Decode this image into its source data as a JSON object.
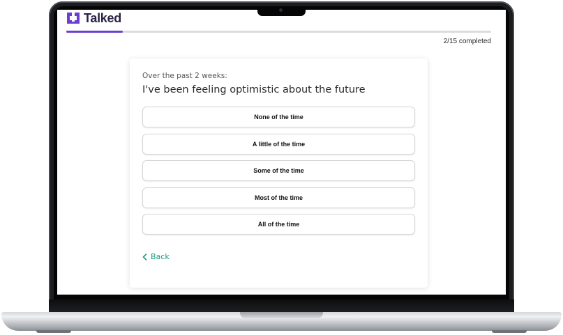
{
  "brand": {
    "name": "Talked",
    "color": "#6c3fd1"
  },
  "progress": {
    "label": "2/15 completed",
    "completed": 2,
    "total": 15,
    "fraction": 0.1333
  },
  "question": {
    "prompt": "Over the past 2 weeks:",
    "text": "I've been feeling optimistic about the future"
  },
  "options": [
    {
      "label": "None of the time"
    },
    {
      "label": "A little of the time"
    },
    {
      "label": "Some of the time"
    },
    {
      "label": "Most of the time"
    },
    {
      "label": "All of the time"
    }
  ],
  "navigation": {
    "back_label": "Back",
    "back_icon": "chevron-left-icon",
    "accent_color": "#1f9c84"
  }
}
